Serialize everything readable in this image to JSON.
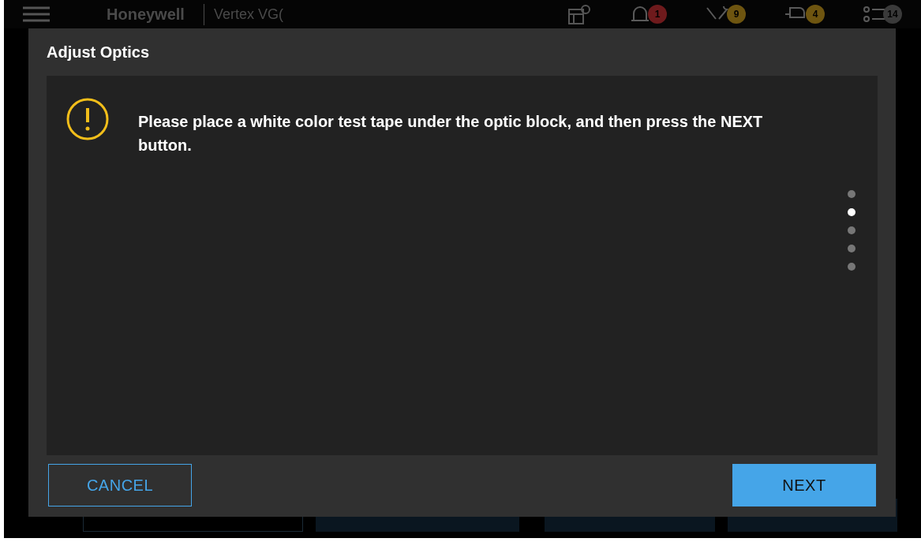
{
  "header": {
    "brand": "Honeywell",
    "product": "Vertex VG(",
    "badges": [
      {
        "count": "1",
        "color": "#6e1a1c"
      },
      {
        "count": "9",
        "color": "#6e5510"
      },
      {
        "count": "4",
        "color": "#6e5510"
      },
      {
        "count": "14",
        "color": "#3a3a3a"
      }
    ]
  },
  "dialog": {
    "title": "Adjust Optics",
    "message": "Please place a white color test tape under the optic block, and then press the NEXT button.",
    "steps": [
      {
        "selected": false
      },
      {
        "selected": true
      },
      {
        "selected": false
      },
      {
        "selected": false
      },
      {
        "selected": false
      }
    ],
    "buttons": [
      {
        "label": "CANCEL",
        "kind": "secondary"
      },
      {
        "label": "NEXT",
        "kind": "primary"
      }
    ]
  }
}
